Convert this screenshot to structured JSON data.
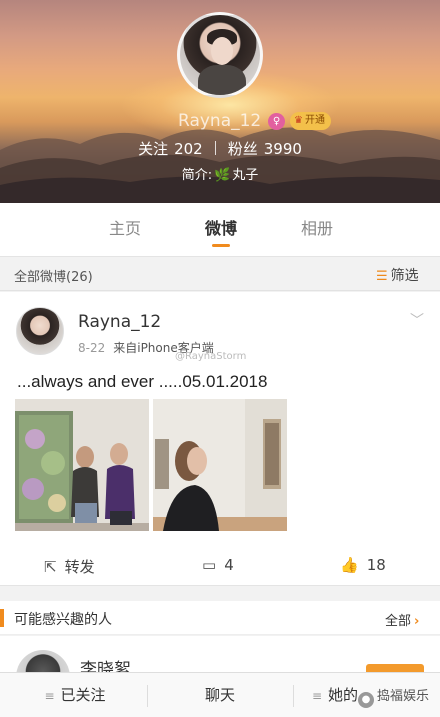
{
  "profile": {
    "username": "Rayna_12",
    "vip_label": "开通",
    "following_label": "关注",
    "following_count": "202",
    "followers_label": "粉丝",
    "followers_count": "3990",
    "bio_label": "简介:",
    "bio_text": "丸子"
  },
  "tabs": [
    {
      "label": "主页",
      "active": false
    },
    {
      "label": "微博",
      "active": true
    },
    {
      "label": "相册",
      "active": false
    }
  ],
  "filter": {
    "count_text": "全部微博(26)",
    "filter_label": "筛选"
  },
  "post": {
    "author": "Rayna_12",
    "date": "8-22",
    "source": "来自iPhone客户端",
    "watermark": "@RaynaStorm",
    "text": "...always and ever .....05.01.2018",
    "repost_label": "转发",
    "comment_count": "4",
    "like_count": "18"
  },
  "suggestions": {
    "title": "可能感兴趣的人",
    "all_label": "全部",
    "first_name": "李晓絮"
  },
  "bottom_bar": {
    "followed_label": "已关注",
    "chat_label": "聊天",
    "her_label": "她的",
    "wechat_label": "捣福娱乐"
  },
  "colors": {
    "accent": "#f08b1e",
    "vip": "#f3c04a"
  }
}
